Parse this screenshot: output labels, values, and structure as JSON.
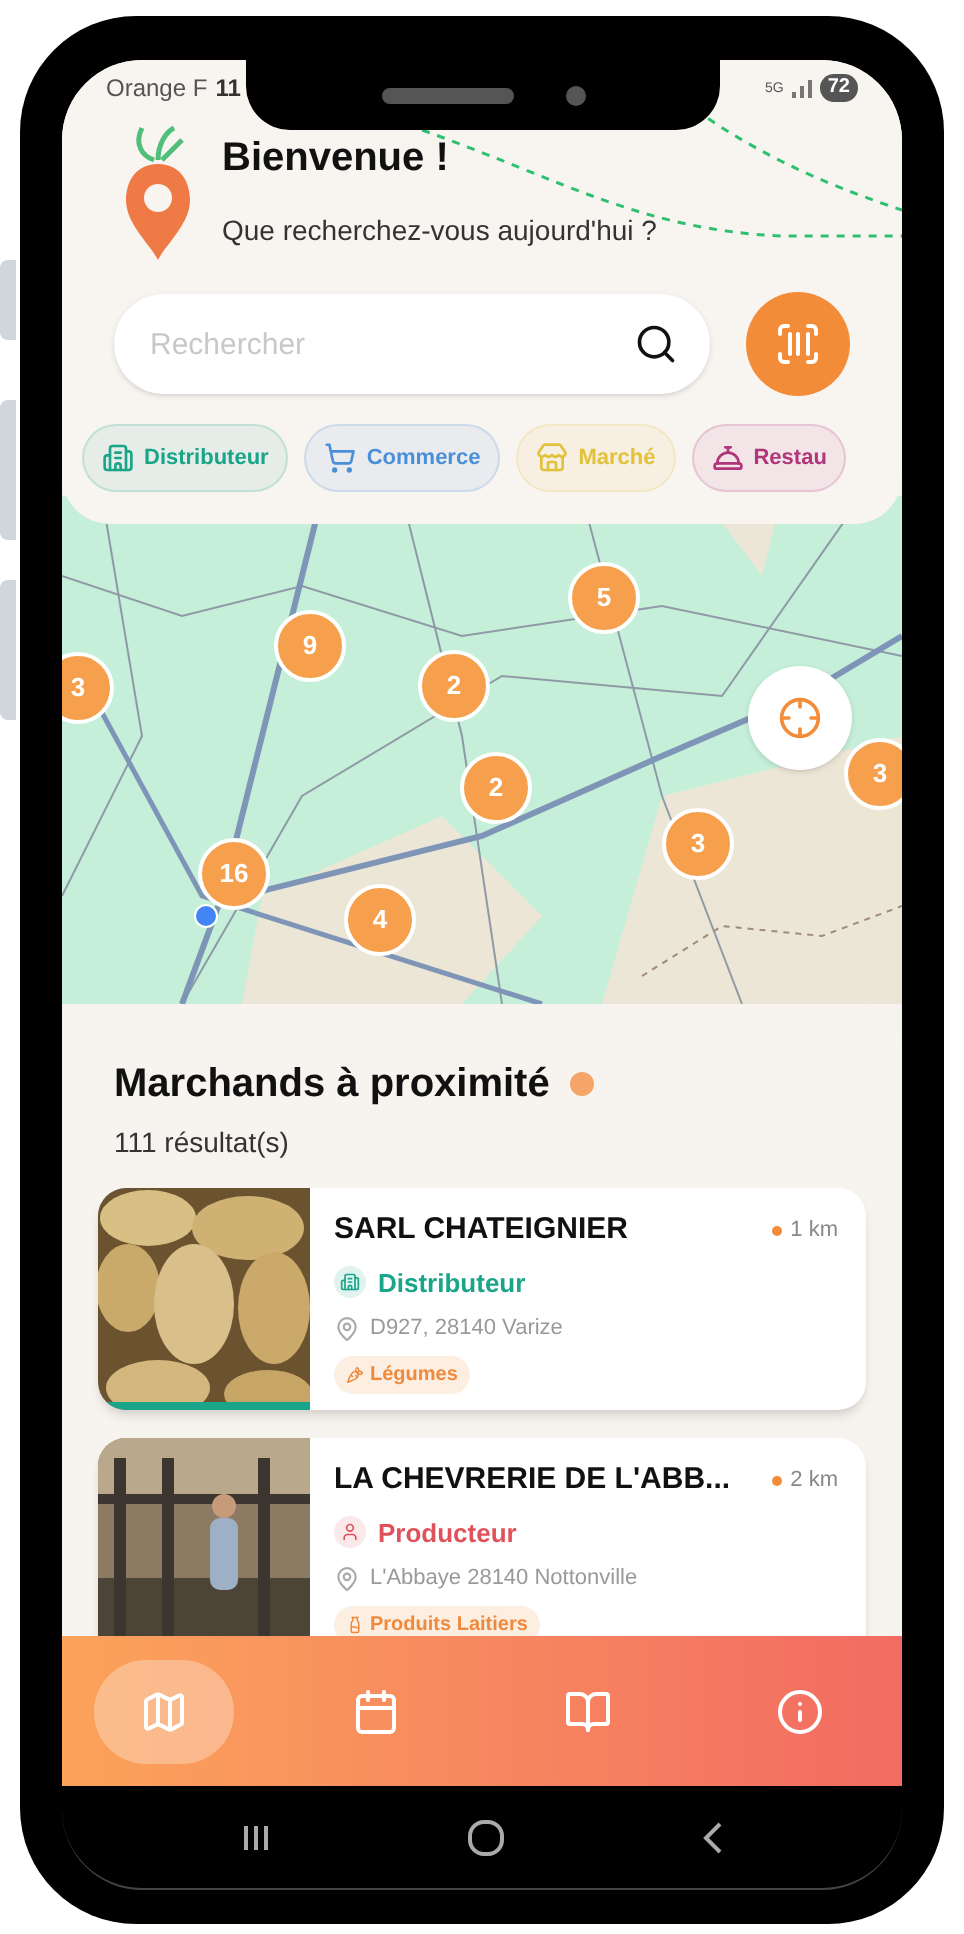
{
  "status_bar": {
    "carrier": "Orange F",
    "time": "11",
    "network": "5G",
    "battery": "72"
  },
  "header": {
    "title": "Bienvenue !",
    "subtitle": "Que recherchez-vous aujourd'hui ?"
  },
  "search": {
    "placeholder": "Rechercher"
  },
  "categories": [
    {
      "label": "Distributeur",
      "color": "#1aa58a",
      "kind": "distributor"
    },
    {
      "label": "Commerce",
      "color": "#4a90d9",
      "kind": "shop"
    },
    {
      "label": "Marché",
      "color": "#e2c23a",
      "kind": "market"
    },
    {
      "label": "Restau",
      "color": "#b0357a",
      "kind": "restaurant"
    }
  ],
  "map": {
    "clusters": [
      {
        "count": "3"
      },
      {
        "count": "9"
      },
      {
        "count": "5"
      },
      {
        "count": "2"
      },
      {
        "count": "2"
      },
      {
        "count": "16"
      },
      {
        "count": "4"
      },
      {
        "count": "3"
      },
      {
        "count": "3"
      }
    ]
  },
  "sheet": {
    "title": "Marchands à proximité",
    "count": "111 résultat(s)",
    "merchants": [
      {
        "name": "SARL CHATEIGNIER",
        "distance": "1 km",
        "type": {
          "label": "Distributeur",
          "color": "#1aa58a",
          "kind": "distributor"
        },
        "address": "D927, 28140 Varize",
        "tag": {
          "label": "Légumes",
          "kind": "vegetables"
        }
      },
      {
        "name": "LA CHEVRERIE DE L'ABB...",
        "distance": "2 km",
        "type": {
          "label": "Producteur",
          "color": "#e0525a",
          "kind": "producer"
        },
        "address": "L'Abbaye 28140 Nottonville",
        "tag": {
          "label": "Produits Laitiers",
          "kind": "dairy"
        }
      }
    ]
  },
  "nav": [
    {
      "kind": "map",
      "selected": true
    },
    {
      "kind": "calendar",
      "selected": false
    },
    {
      "kind": "book",
      "selected": false
    },
    {
      "kind": "info",
      "selected": false
    }
  ]
}
